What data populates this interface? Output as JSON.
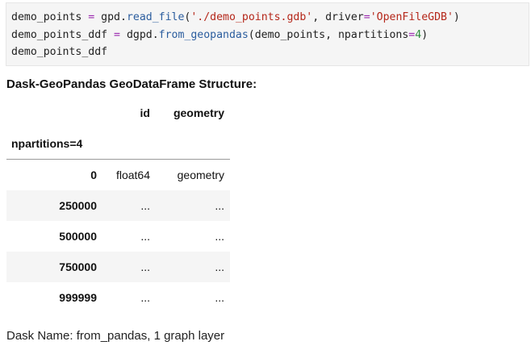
{
  "code": {
    "line1": {
      "var": "demo_points ",
      "eq": "=",
      "obj": " gpd.",
      "fn": "read_file",
      "open": "(",
      "path": "'./demo_points.gdb'",
      "comma": ", driver",
      "eq2": "=",
      "driver": "'OpenFileGDB'",
      "close": ")"
    },
    "line2": {
      "var": "demo_points_ddf ",
      "eq": "=",
      "obj": " dgpd.",
      "fn": "from_geopandas",
      "args": "(demo_points, npartitions",
      "eq2": "=",
      "num": "4",
      "close": ")"
    },
    "line3": "demo_points_ddf"
  },
  "output": {
    "title": "Dask-GeoPandas GeoDataFrame Structure:",
    "columns": [
      "id",
      "geometry"
    ],
    "index_name": "npartitions=4",
    "rows": [
      {
        "index": "0",
        "values": [
          "float64",
          "geometry"
        ]
      },
      {
        "index": "250000",
        "values": [
          "...",
          "..."
        ]
      },
      {
        "index": "500000",
        "values": [
          "...",
          "..."
        ]
      },
      {
        "index": "750000",
        "values": [
          "...",
          "..."
        ]
      },
      {
        "index": "999999",
        "values": [
          "...",
          "..."
        ]
      }
    ],
    "footer": "Dask Name: from_pandas, 1 graph layer"
  }
}
